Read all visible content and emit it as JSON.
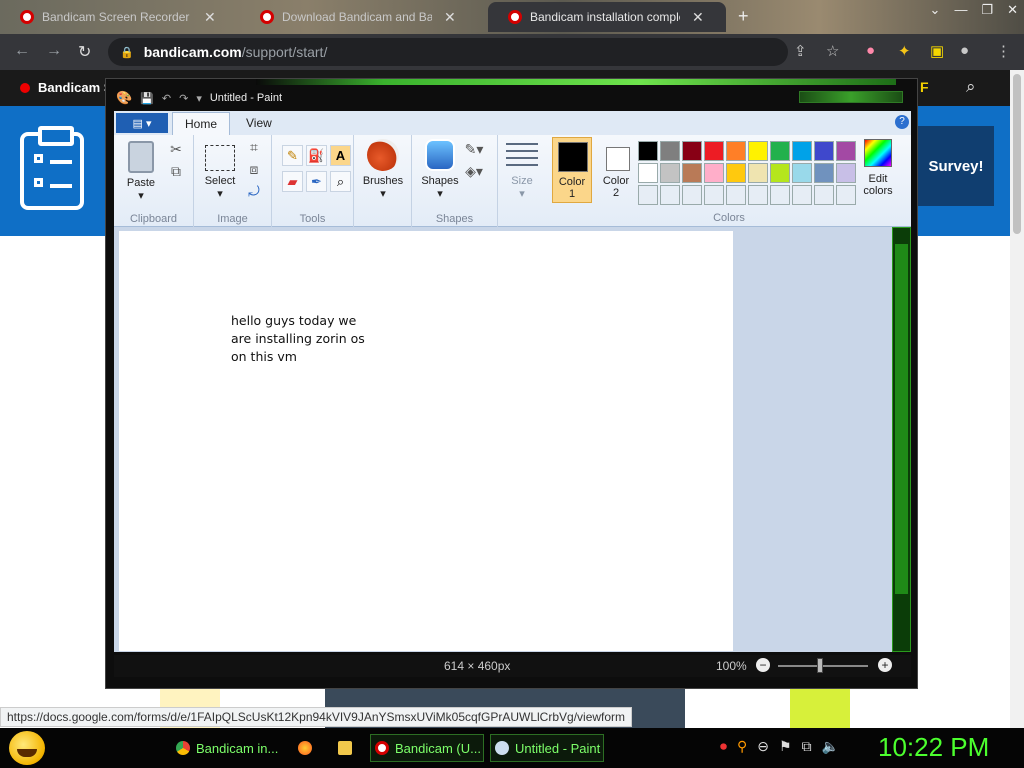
{
  "browser": {
    "tabs": [
      {
        "title": "Bandicam Screen Recorder Dow",
        "active": false
      },
      {
        "title": "Download Bandicam and Bandic",
        "active": false
      },
      {
        "title": "Bandicam installation complete",
        "active": true
      }
    ],
    "url_host": "bandicam.com",
    "url_path": "/support/start/",
    "status_url": "https://docs.google.com/forms/d/e/1FAIpQLScUsKt12Kpn94kVIV9JAnYSmsxUViMk05cqfGPrAUWLlCrbVg/viewform"
  },
  "website": {
    "brand": "Bandicam S",
    "corner_text": "F",
    "survey_button": "Survey!"
  },
  "paint": {
    "title": "Untitled - Paint",
    "ribbon_tabs": [
      "Home",
      "View"
    ],
    "groups": {
      "clipboard": "Clipboard",
      "image": "Image",
      "tools": "Tools",
      "shapes": "Shapes",
      "colors": "Colors"
    },
    "buttons": {
      "paste": "Paste",
      "select": "Select",
      "brushes": "Brushes",
      "shapes": "Shapes",
      "size": "Size",
      "color1": "Color\n1",
      "color2": "Color\n2",
      "edit_colors": "Edit\ncolors"
    },
    "canvas_text": [
      "hello guys today we",
      "are installing zorin os",
      "on this vm"
    ],
    "status": {
      "dimensions": "614 × 460px",
      "zoom": "100%"
    },
    "palette_row1": [
      "#000000",
      "#7f7f7f",
      "#880015",
      "#ed1c24",
      "#ff7f27",
      "#fff200",
      "#22b14c",
      "#00a2e8",
      "#3f48cc",
      "#a349a4"
    ],
    "palette_row2": [
      "#ffffff",
      "#c3c3c3",
      "#b97a57",
      "#ffaec9",
      "#ffc90e",
      "#efe4b0",
      "#b5e61d",
      "#99d9ea",
      "#7092be",
      "#c8bfe7"
    ],
    "palette_row3": [
      "#e6edf5",
      "#e6edf5",
      "#e6edf5",
      "#e6edf5",
      "#e6edf5",
      "#e6edf5",
      "#e6edf5",
      "#e6edf5",
      "#e6edf5",
      "#e6edf5"
    ]
  },
  "taskbar": {
    "items": [
      {
        "label": "Bandicam in...",
        "icon": "chrome-icon"
      },
      {
        "label": "",
        "icon": "firefox-icon"
      },
      {
        "label": "",
        "icon": "folder-icon"
      },
      {
        "label": "Bandicam (U...",
        "icon": "bandicam-icon"
      },
      {
        "label": "Untitled - Paint",
        "icon": "paint-icon"
      }
    ],
    "clock": "10:22 PM"
  }
}
